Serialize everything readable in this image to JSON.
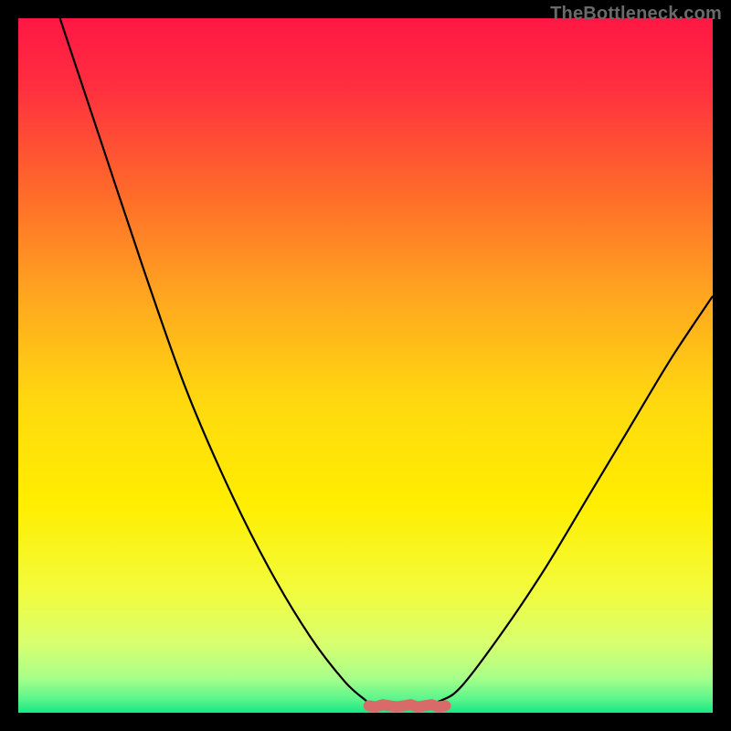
{
  "watermark": "TheBottleneck.com",
  "gradient": {
    "stops": [
      {
        "offset": 0.0,
        "color": "#ff1744"
      },
      {
        "offset": 0.1,
        "color": "#ff2f3f"
      },
      {
        "offset": 0.25,
        "color": "#ff6a2a"
      },
      {
        "offset": 0.4,
        "color": "#ffa61f"
      },
      {
        "offset": 0.55,
        "color": "#ffd80f"
      },
      {
        "offset": 0.7,
        "color": "#ffee00"
      },
      {
        "offset": 0.82,
        "color": "#f3fb3a"
      },
      {
        "offset": 0.9,
        "color": "#d8ff6e"
      },
      {
        "offset": 0.95,
        "color": "#a8ff8a"
      },
      {
        "offset": 0.98,
        "color": "#5cf58c"
      },
      {
        "offset": 1.0,
        "color": "#17e884"
      }
    ]
  },
  "curve": {
    "stroke": "#000000",
    "strokeWidth": 2.2,
    "points": [
      {
        "x": 0.06,
        "y": 1.0
      },
      {
        "x": 0.12,
        "y": 0.82
      },
      {
        "x": 0.18,
        "y": 0.64
      },
      {
        "x": 0.24,
        "y": 0.47
      },
      {
        "x": 0.3,
        "y": 0.33
      },
      {
        "x": 0.36,
        "y": 0.21
      },
      {
        "x": 0.42,
        "y": 0.11
      },
      {
        "x": 0.47,
        "y": 0.045
      },
      {
        "x": 0.5,
        "y": 0.018
      },
      {
        "x": 0.51,
        "y": 0.01
      },
      {
        "x": 0.54,
        "y": 0.01
      },
      {
        "x": 0.58,
        "y": 0.012
      },
      {
        "x": 0.61,
        "y": 0.018
      },
      {
        "x": 0.64,
        "y": 0.04
      },
      {
        "x": 0.7,
        "y": 0.12
      },
      {
        "x": 0.76,
        "y": 0.21
      },
      {
        "x": 0.82,
        "y": 0.31
      },
      {
        "x": 0.88,
        "y": 0.41
      },
      {
        "x": 0.94,
        "y": 0.51
      },
      {
        "x": 1.0,
        "y": 0.6
      }
    ]
  },
  "floor_band": {
    "stroke": "#d96a6a",
    "strokeWidth": 12,
    "y": 0.01,
    "x0": 0.505,
    "x1": 0.615,
    "jitter": [
      0,
      1,
      -1,
      0,
      1,
      0,
      -1,
      1,
      0,
      -1,
      1,
      0
    ]
  },
  "chart_data": {
    "type": "line",
    "title": "",
    "xlabel": "",
    "ylabel": "",
    "xlim": [
      0,
      1
    ],
    "ylim": [
      0,
      1
    ],
    "series": [
      {
        "name": "bottleneck-curve",
        "x": [
          0.06,
          0.12,
          0.18,
          0.24,
          0.3,
          0.36,
          0.42,
          0.47,
          0.5,
          0.51,
          0.54,
          0.58,
          0.61,
          0.64,
          0.7,
          0.76,
          0.82,
          0.88,
          0.94,
          1.0
        ],
        "y": [
          1.0,
          0.82,
          0.64,
          0.47,
          0.33,
          0.21,
          0.11,
          0.045,
          0.018,
          0.01,
          0.01,
          0.012,
          0.018,
          0.04,
          0.12,
          0.21,
          0.31,
          0.41,
          0.51,
          0.6
        ]
      },
      {
        "name": "optimal-flat-region",
        "x": [
          0.505,
          0.615
        ],
        "y": [
          0.01,
          0.01
        ]
      }
    ],
    "legend": [],
    "annotations": [
      "TheBottleneck.com"
    ]
  }
}
